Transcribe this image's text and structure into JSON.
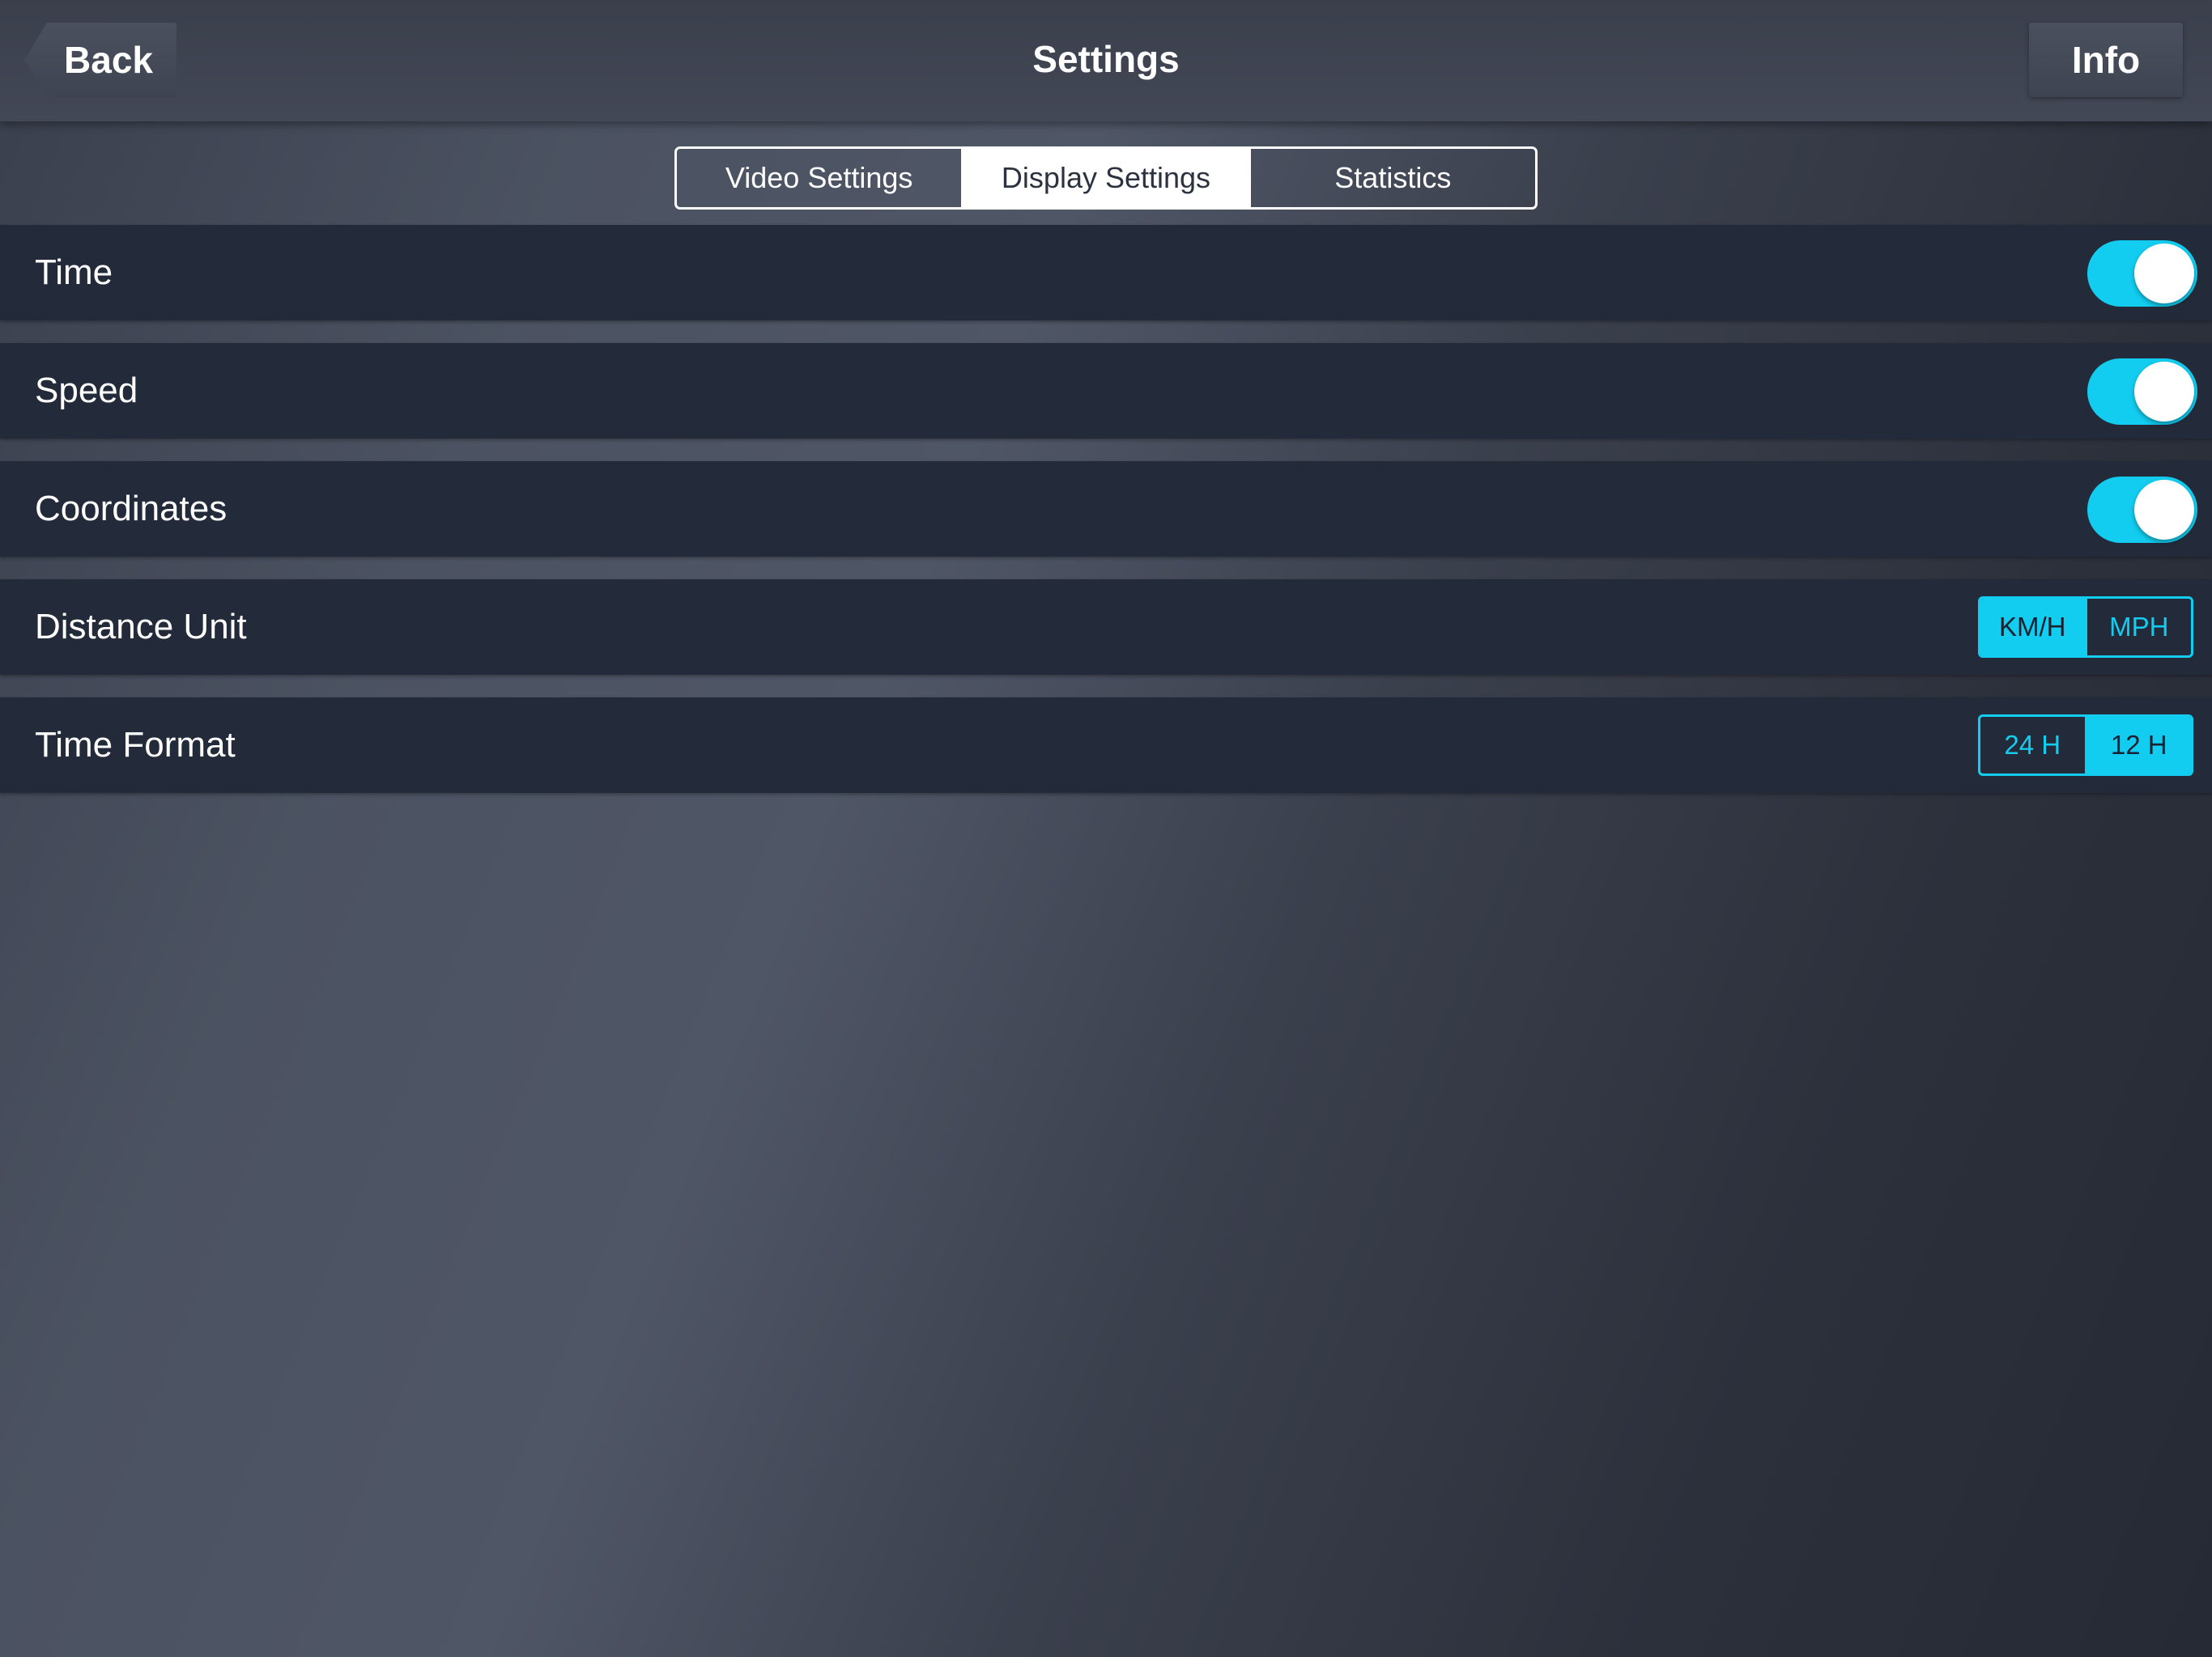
{
  "colors": {
    "accent": "#12cdf0",
    "row_background": "#232a39",
    "nav_background": "#3f4451"
  },
  "navbar": {
    "back_label": "Back",
    "title": "Settings",
    "info_label": "Info"
  },
  "tabs": [
    {
      "label": "Video Settings",
      "active": false
    },
    {
      "label": "Display Settings",
      "active": true
    },
    {
      "label": "Statistics",
      "active": false
    }
  ],
  "rows": {
    "time": {
      "label": "Time",
      "enabled": true
    },
    "speed": {
      "label": "Speed",
      "enabled": true
    },
    "coordinates": {
      "label": "Coordinates",
      "enabled": true
    },
    "distance_unit": {
      "label": "Distance Unit",
      "options": [
        "KM/H",
        "MPH"
      ],
      "selected": "KM/H"
    },
    "time_format": {
      "label": "Time Format",
      "options": [
        "24 H",
        "12 H"
      ],
      "selected": "12 H"
    }
  }
}
